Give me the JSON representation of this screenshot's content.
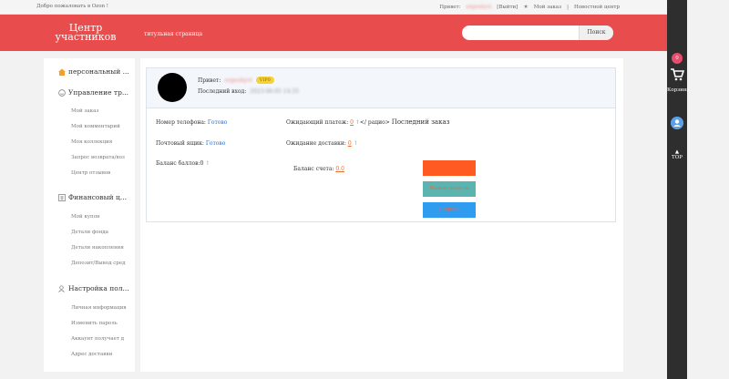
{
  "topbar": {
    "welcome": "Добро пожаловать в Ozon !",
    "greeting": "Привет:",
    "username": "orgenhyvl",
    "logout": "[Выйти]",
    "my_orders": "Мой заказ",
    "news": "Новостной центр"
  },
  "header": {
    "logo_line1": "Центр",
    "logo_line2": "участников",
    "home_link": "титульная страница",
    "search_placeholder": "",
    "search_button": "Поиск"
  },
  "rail": {
    "cart_count": "0",
    "cart_label": "Корзина",
    "top_label": "TOP"
  },
  "sidebar": {
    "sections": [
      {
        "label": "персональный ...",
        "icon": "home-icon",
        "color": "#f0a030"
      },
      {
        "label": "Управление тр...",
        "icon": "smile-icon",
        "items": [
          "Мой заказ",
          "Мой комментарий",
          "Моя коллекция",
          "Запрос возврата/воз",
          "Центр отзывов"
        ]
      },
      {
        "label": "Финансовый ц...",
        "icon": "finance-icon",
        "items": [
          "Мой купон",
          "Детали фонда",
          "Детали накопления",
          "Депозит/Вывод сред"
        ]
      },
      {
        "label": "Настройка пол...",
        "icon": "user-settings-icon",
        "items": [
          "Личная информация",
          "Изменить пароль",
          "Аккаунт получает д",
          "Адрес доставки"
        ]
      }
    ]
  },
  "profile": {
    "greeting": "Привет:",
    "username": "orgenhyvl",
    "vip": "VIP0",
    "last_login_label": "Последний вход:",
    "last_login_value": "2023-06-05 14:35"
  },
  "info": {
    "phone_label": "Номер телефона:",
    "phone_value": "Готово",
    "pending_pay_label": "Ожидающий платеж:",
    "pending_pay_value": "0",
    "pending_pay_suffix": "</ рацио>",
    "last_order": "Последний заказ",
    "email_label": "Почтовый ящик:",
    "email_value": "Готово",
    "pending_delivery_label": "Ожидание доставки:",
    "pending_delivery_value": "0",
    "points_label": "Баланс баллов:",
    "points_value": "0",
    "balance_label": "Баланс счета:",
    "balance_value": "0.0",
    "btn_withdraw": "Вывод средств",
    "btn_topup": "Пополн"
  },
  "colors": {
    "brand_red": "#e84c4c",
    "orange": "#ff5a22",
    "teal": "#5bb4b0",
    "blue": "#2f9cf0"
  }
}
